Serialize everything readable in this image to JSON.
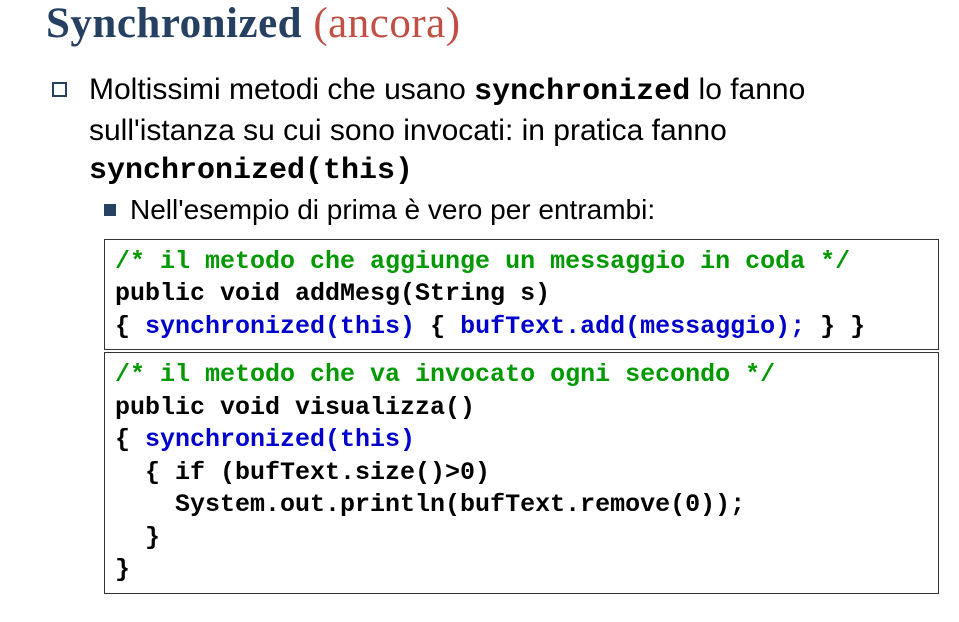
{
  "title": {
    "main": "Synchronized",
    "paren": "(ancora)"
  },
  "bullet1": {
    "t1": "Moltissimi metodi che usano ",
    "kw1": "synchronized",
    "t2": " lo fanno sull'istanza su cui sono invocati: in pratica fanno ",
    "kw2": "synchronized(this)"
  },
  "bullet2": "Nell'esempio di prima è vero per entrambi:",
  "code1": {
    "l1": "/* il metodo che aggiunge un messaggio in coda */",
    "l2": "public void addMesg(String s)",
    "l3a": "{ ",
    "l3b": "synchronized(this)",
    "l3c": " { ",
    "l3d": "bufText.add(messaggio);",
    "l3e": " } }"
  },
  "code2": {
    "l1": "/* il metodo che va invocato ogni secondo */",
    "l2": "public void visualizza()",
    "l3a": "{ ",
    "l3b": "synchronized(this)",
    "l4": "  { if (bufText.size()>0)",
    "l5": "    System.out.println(bufText.remove(0));",
    "l6": "  }",
    "l7": "}"
  }
}
